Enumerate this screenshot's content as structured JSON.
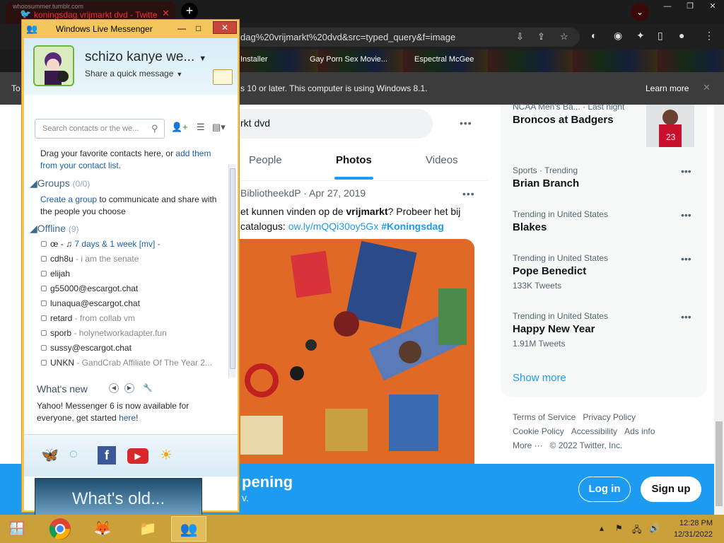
{
  "chrome": {
    "tab_url_hint": "whoosummer.tumblr.com",
    "tab_title": "koningsdag vrijmarkt dvd - Twitte",
    "tab_close": "✕",
    "new_tab": "+",
    "address": "dag%20vrijmarkt%20dvd&src=typed_query&f=image",
    "bookmarks": [
      "Installer",
      "Gay Porn Sex Movie...",
      "Espectral McGee"
    ],
    "infobar_text": "s 10 or later. This computer is using Windows 8.1.",
    "infobar_learn": "Learn more",
    "infobar_close": "✕",
    "prefix_letter": "To"
  },
  "twitter": {
    "search_value": "rkt dvd",
    "tabs": [
      "People",
      "Photos",
      "Videos"
    ],
    "tweet_meta": "BibliotheekdP · Apr 27, 2019",
    "tweet_line1_pre": "et kunnen vinden op de ",
    "tweet_line1_bold": "vrijmarkt",
    "tweet_line1_post": "? Probeer het bij",
    "tweet_line2_pre": "catalogus: ",
    "tweet_link": "ow.ly/mQQi30oy5Gx",
    "tweet_hashtag": "#Koningsdag",
    "trends": [
      {
        "context": "NCAA Men's Ba... · Last night",
        "title": "Broncos at Badgers",
        "count": ""
      },
      {
        "context": "Sports · Trending",
        "title": "Brian Branch",
        "count": ""
      },
      {
        "context": "Trending in United States",
        "title": "Blakes",
        "count": ""
      },
      {
        "context": "Trending in United States",
        "title": "Pope Benedict",
        "count": "133K Tweets"
      },
      {
        "context": "Trending in United States",
        "title": "Happy New Year",
        "count": "1.91M Tweets"
      }
    ],
    "show_more": "Show more",
    "footer": [
      "Terms of Service",
      "Privacy Policy",
      "Cookie Policy",
      "Accessibility",
      "Ads info",
      "More ···",
      "© 2022 Twitter, Inc."
    ],
    "banner_title": "pening",
    "banner_sub": "v.",
    "login": "Log in",
    "signup": "Sign up"
  },
  "messenger": {
    "title": "Windows Live Messenger",
    "username": "schizo kanye we...",
    "quick_message": "Share a quick message",
    "search_placeholder": "Search contacts or the we...",
    "hint_pre": "Drag your favorite contacts here, or ",
    "hint_link": "add them from your contact list.",
    "groups_label": "Groups",
    "groups_count": "(0/0)",
    "groups_hint_link": "Create a group",
    "groups_hint_rest": " to communicate and share with the people you choose",
    "offline_label": "Offline",
    "offline_count": "(9)",
    "contacts": [
      {
        "name": "œ - ♫ ",
        "msg": "7 days & 1 week [mv] -"
      },
      {
        "name": "cdh8u",
        "msg": " - i am the senate"
      },
      {
        "name": "elijah",
        "msg": ""
      },
      {
        "name": "g55000@escargot.chat",
        "msg": ""
      },
      {
        "name": "lunaqua@escargot.chat",
        "msg": ""
      },
      {
        "name": "retard",
        "msg": " - from collab vm"
      },
      {
        "name": "sporb",
        "msg": " - holynetworkadapter.fun"
      },
      {
        "name": "sussy@escargot.chat",
        "msg": ""
      },
      {
        "name": "UNKN",
        "msg": " - GandCrab Affiliate Of The Year 2..."
      }
    ],
    "whats_new": "What's new",
    "news_text": "Yahoo! Messenger 6 is now available for everyone, get started ",
    "news_link": "here",
    "news_end": "!",
    "ad_text": "What's old..."
  },
  "taskbar": {
    "time": "12:28 PM",
    "date": "12/31/2022"
  }
}
